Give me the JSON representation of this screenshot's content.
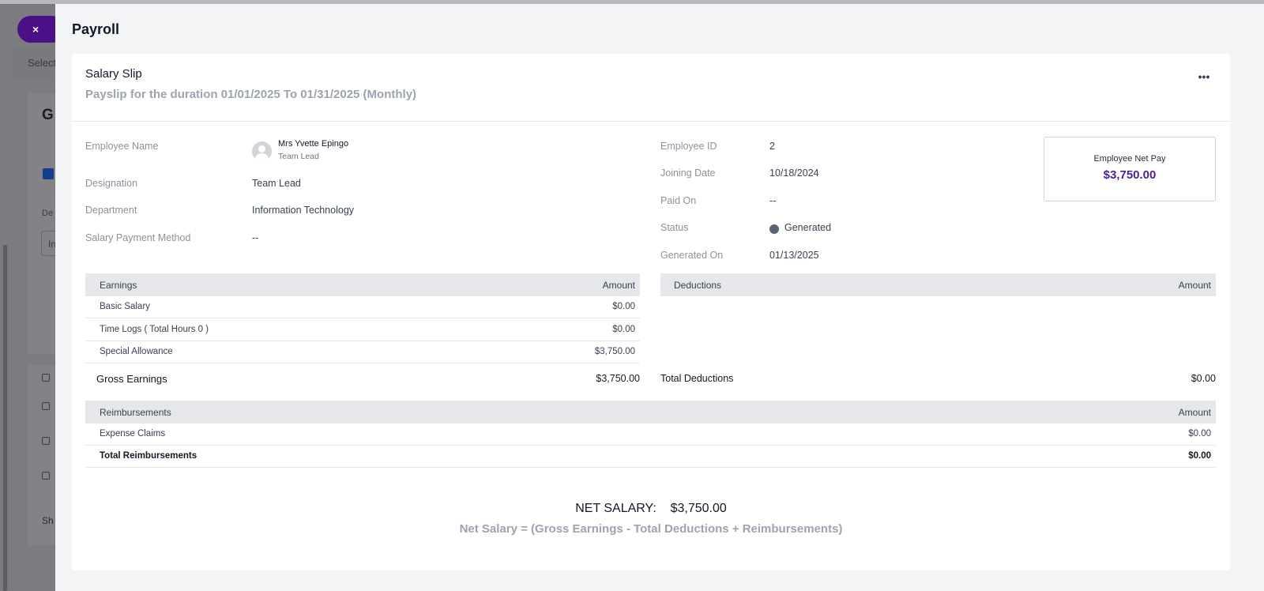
{
  "background": {
    "close_label": "×",
    "select_label": "Select",
    "card_heading": "G",
    "dept_label": "De",
    "input_value": "In",
    "footer_text": "Sh"
  },
  "drawer": {
    "title": "Payroll"
  },
  "slip": {
    "title": "Salary Slip",
    "subtitle": "Payslip for the duration 01/01/2025 To 01/31/2025 (Monthly)",
    "more_label": "•••"
  },
  "employee": {
    "name_label": "Employee Name",
    "name": "Mrs Yvette Epingo",
    "role": "Team Lead",
    "designation_label": "Designation",
    "designation": "Team Lead",
    "department_label": "Department",
    "department": "Information Technology",
    "payment_method_label": "Salary Payment Method",
    "payment_method": "--",
    "id_label": "Employee ID",
    "id": "2",
    "joining_label": "Joining Date",
    "joining": "10/18/2024",
    "paid_on_label": "Paid On",
    "paid_on": "--",
    "status_label": "Status",
    "status": "Generated",
    "generated_on_label": "Generated On",
    "generated_on": "01/13/2025"
  },
  "net_pay_card": {
    "label": "Employee Net Pay",
    "value": "$3,750.00"
  },
  "earnings": {
    "header": "Earnings",
    "amount_header": "Amount",
    "rows": [
      {
        "name": "Basic Salary",
        "amount": "$0.00"
      },
      {
        "name": "Time Logs ( Total Hours 0 )",
        "amount": "$0.00"
      },
      {
        "name": "Special Allowance",
        "amount": "$3,750.00"
      }
    ],
    "total_label": "Gross Earnings",
    "total": "$3,750.00"
  },
  "deductions": {
    "header": "Deductions",
    "amount_header": "Amount",
    "total_label": "Total Deductions",
    "total": "$0.00"
  },
  "reimbursements": {
    "header": "Reimbursements",
    "amount_header": "Amount",
    "rows": [
      {
        "name": "Expense Claims",
        "amount": "$0.00"
      }
    ],
    "total_label": "Total Reimbursements",
    "total": "$0.00"
  },
  "net_salary": {
    "label": "NET SALARY:",
    "value": "$3,750.00",
    "formula": "Net Salary = (Gross Earnings - Total Deductions + Reimbursements)"
  },
  "colors": {
    "accent": "#4c1d95",
    "status_generated": "#5b6472"
  }
}
